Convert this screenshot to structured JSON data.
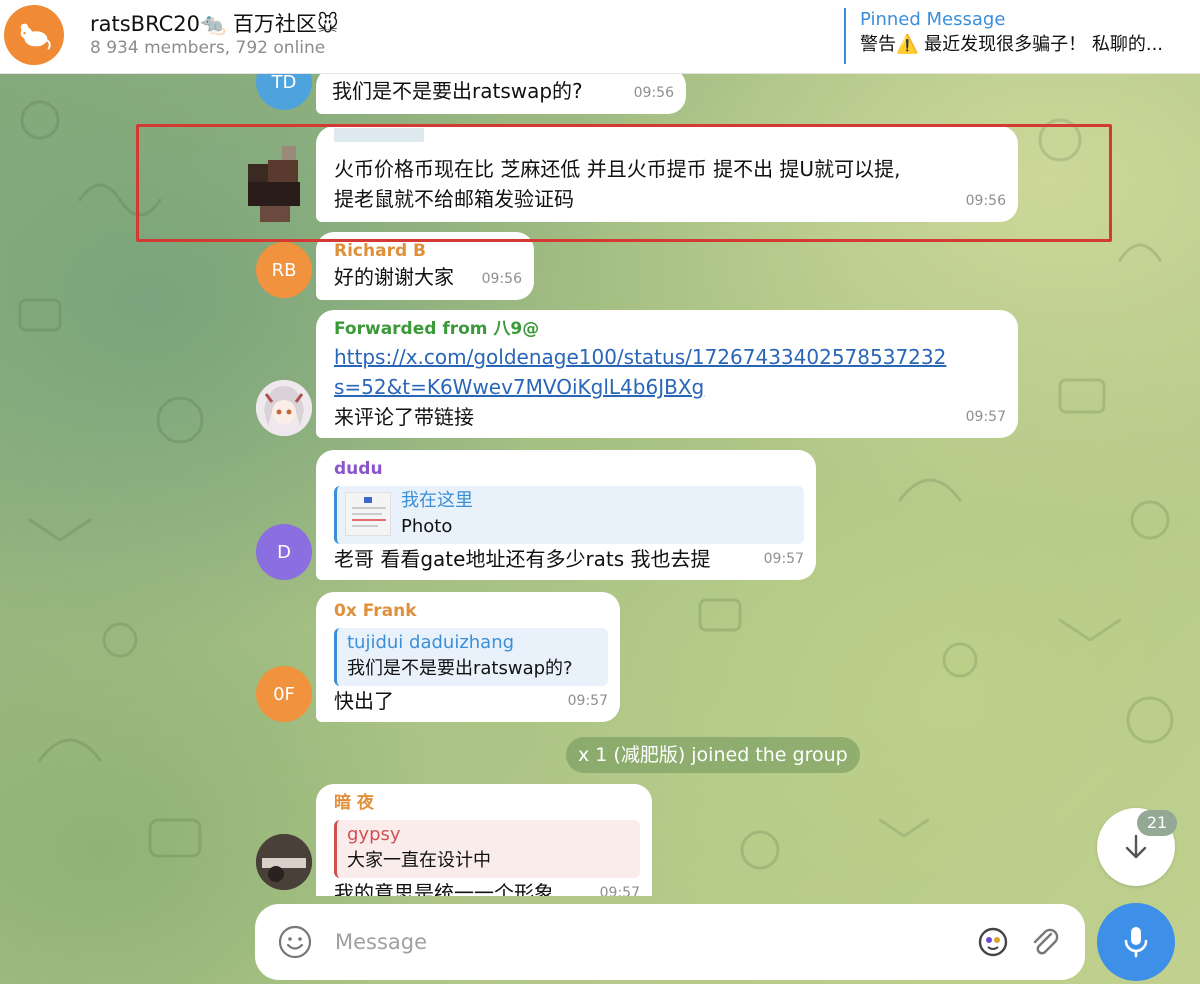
{
  "group": {
    "title": "ratsBRC20🐀 百万社区🐭",
    "subtitle": "8 934 members, 792 online"
  },
  "pinned": {
    "title": "Pinned Message",
    "text": "警告⚠️ 最近发现很多骗子！ 私聊的..."
  },
  "messages": {
    "m1": {
      "avatar": "TD",
      "avatar_color": "#4fa3dd",
      "text": "我们是不是要出ratswap的?",
      "time": "09:56"
    },
    "m2": {
      "line1": "火币价格币现在比 芝麻还低 并且火币提币 提不出 提U就可以提,",
      "line2": "提老鼠就不给邮箱发验证码",
      "time": "09:56"
    },
    "m3": {
      "sender": "Richard B",
      "sender_color": "#e0903a",
      "avatar": "RB",
      "avatar_color": "#f0923e",
      "text": "好的谢谢大家",
      "time": "09:56"
    },
    "m4": {
      "forwarded": "Forwarded from 八9@",
      "link_line1": "https://x.com/goldenage100/status/17267433402578537232",
      "link_line2": "s=52&t=K6Wwev7MVOiKglL4b6JBXg",
      "text": "来评论了带链接",
      "time": "09:57"
    },
    "m5": {
      "sender": "dudu",
      "sender_color": "#8a55c8",
      "avatar": "D",
      "avatar_color": "#8b6ee0",
      "reply_name": "我在这里",
      "reply_text": "Photo",
      "text": "老哥 看看gate地址还有多少rats 我也去提",
      "time": "09:57"
    },
    "m6": {
      "sender": "0x Frank",
      "sender_color": "#e0903a",
      "avatar": "0F",
      "avatar_color": "#f0923e",
      "reply_name": "tujidui daduizhang",
      "reply_text": "我们是不是要出ratswap的?",
      "text": "快出了",
      "time": "09:57"
    },
    "service": "x 1 (减肥版) joined the group",
    "m7": {
      "sender": "暗 夜",
      "sender_color": "#e0903a",
      "reply_name": "gypsy",
      "reply_text": "大家一直在设计中",
      "text": "我的意思是统一一个形象",
      "time": "09:57"
    }
  },
  "scroll": {
    "unread": "21"
  },
  "composer": {
    "placeholder": "Message"
  },
  "colors": {
    "accent": "#3a8fd8",
    "highlight": "#d23a32",
    "link": "#2a66b8"
  }
}
